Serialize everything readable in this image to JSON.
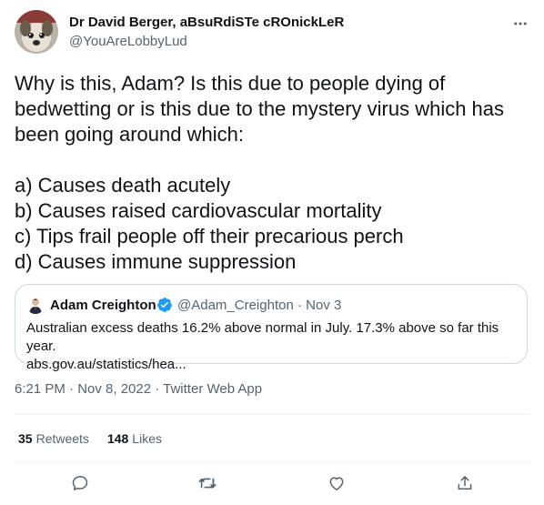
{
  "author": {
    "name": "Dr David Berger, aBsuRdiSTe cROnickLeR",
    "handle": "@YouAreLobbyLud",
    "avatar_icon": "dog-avatar"
  },
  "tweet": {
    "paragraph1": [
      "Why is this, Adam? Is this due to people dying of",
      "bedwetting or is this due to the mystery virus which has",
      "been going around which:"
    ],
    "list": [
      "a) Causes death acutely",
      "b) Causes raised cardiovascular mortality",
      "c) Tips frail people off their precarious perch",
      "d) Causes immune suppression"
    ]
  },
  "quote": {
    "name": "Adam Creighton",
    "handle_date": "@Adam_Creighton · Nov 3",
    "text": "Australian excess deaths 16.2% above normal in July. 17.3% above so far this year.",
    "link": "abs.gov.au/statistics/hea..."
  },
  "timestamp": "6:21 PM · Nov 8, 2022 · Twitter Web App",
  "stats": {
    "retweets_count": "35",
    "retweets_label": "Retweets",
    "likes_count": "148",
    "likes_label": "Likes"
  },
  "icons": {
    "more": "more-icon",
    "reply": "reply-icon",
    "retweet": "retweet-icon",
    "like": "like-icon",
    "share": "share-icon"
  },
  "colors": {
    "text": "#0f1419",
    "secondary": "#536471",
    "border": "#cfd9de",
    "verified": "#1d9bf0"
  }
}
